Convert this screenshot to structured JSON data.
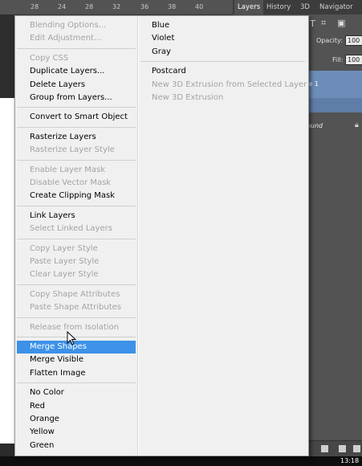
{
  "ruler": {
    "marks": [
      "28",
      "24",
      "28",
      "32",
      "36",
      "38",
      "40"
    ]
  },
  "panel": {
    "tabs": [
      "Layers",
      "History",
      "3D",
      "Navigator"
    ],
    "opacity_label": "Opacity:",
    "opacity_value": "100",
    "fill_label": "Fill:",
    "fill_value": "100",
    "layer_name": "le 1",
    "layer_bg": "ound"
  },
  "taskbar": {
    "time": "13:18"
  },
  "menu": {
    "left_items": [
      {
        "label": "Blending Options...",
        "disabled": true
      },
      {
        "label": "Edit Adjustment...",
        "disabled": true
      },
      {
        "sep": true
      },
      {
        "label": "Copy CSS",
        "disabled": true
      },
      {
        "label": "Duplicate Layers...",
        "disabled": false
      },
      {
        "label": "Delete Layers",
        "disabled": false
      },
      {
        "label": "Group from Layers...",
        "disabled": false
      },
      {
        "sep": true
      },
      {
        "label": "Convert to Smart Object",
        "disabled": false
      },
      {
        "sep": true
      },
      {
        "label": "Rasterize Layers",
        "disabled": false
      },
      {
        "label": "Rasterize Layer Style",
        "disabled": true
      },
      {
        "sep": true
      },
      {
        "label": "Enable Layer Mask",
        "disabled": true
      },
      {
        "label": "Disable Vector Mask",
        "disabled": true
      },
      {
        "label": "Create Clipping Mask",
        "disabled": false
      },
      {
        "sep": true
      },
      {
        "label": "Link Layers",
        "disabled": false
      },
      {
        "label": "Select Linked Layers",
        "disabled": true
      },
      {
        "sep": true
      },
      {
        "label": "Copy Layer Style",
        "disabled": true
      },
      {
        "label": "Paste Layer Style",
        "disabled": true
      },
      {
        "label": "Clear Layer Style",
        "disabled": true
      },
      {
        "sep": true
      },
      {
        "label": "Copy Shape Attributes",
        "disabled": true
      },
      {
        "label": "Paste Shape Attributes",
        "disabled": true
      },
      {
        "sep": true
      },
      {
        "label": "Release from Isolation",
        "disabled": true
      },
      {
        "sep": true
      },
      {
        "label": "Merge Shapes",
        "disabled": false,
        "highlighted": true
      },
      {
        "label": "Merge Visible",
        "disabled": false
      },
      {
        "label": "Flatten Image",
        "disabled": false
      },
      {
        "sep": true
      },
      {
        "label": "No Color",
        "disabled": false
      },
      {
        "label": "Red",
        "disabled": false
      },
      {
        "label": "Orange",
        "disabled": false
      },
      {
        "label": "Yellow",
        "disabled": false
      },
      {
        "label": "Green",
        "disabled": false
      }
    ],
    "right_items": [
      {
        "label": "Blue",
        "disabled": false
      },
      {
        "label": "Violet",
        "disabled": false
      },
      {
        "label": "Gray",
        "disabled": false
      },
      {
        "sep": true
      },
      {
        "label": "Postcard",
        "disabled": false
      },
      {
        "label": "New 3D Extrusion from Selected Layer",
        "disabled": true
      },
      {
        "label": "New 3D Extrusion",
        "disabled": true
      }
    ]
  },
  "colors": {
    "highlight": "#3d91e8",
    "menu_bg": "#f0f0f0",
    "disabled_text": "#a3a3a3"
  }
}
